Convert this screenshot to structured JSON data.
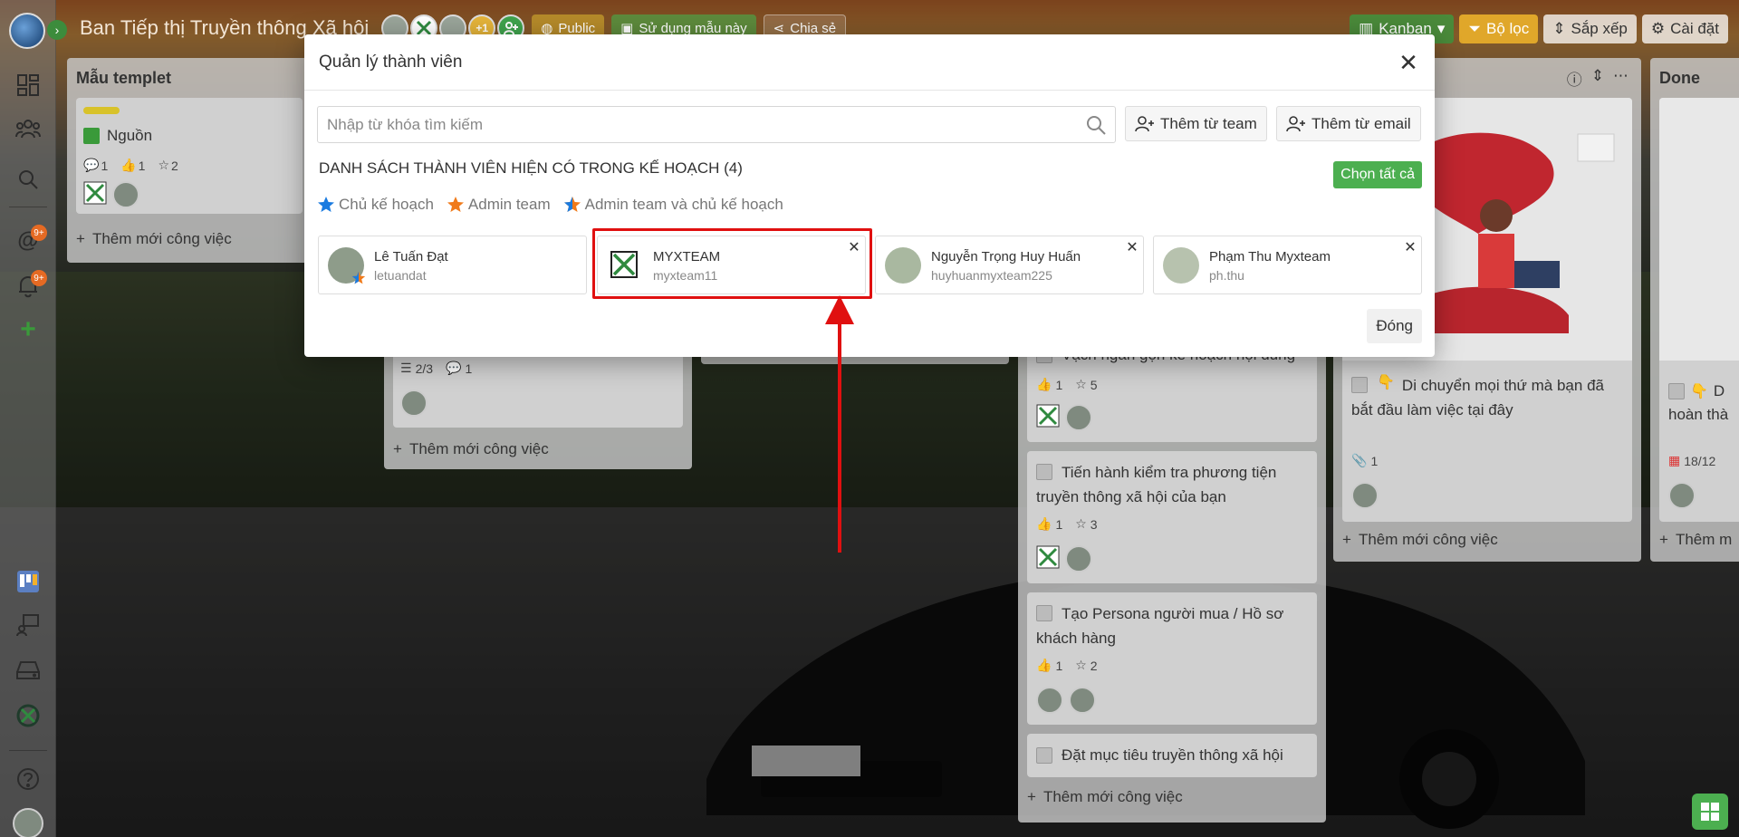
{
  "board": {
    "title": "Ban Tiếp thị Truyền thông Xã hội",
    "more_members": "+1",
    "public_label": "Public",
    "use_template_label": "Sử dụng mẫu này",
    "share_label": "Chia sẻ",
    "view_label": "Kanban",
    "filter_label": "Bộ lọc",
    "sort_label": "Sắp xếp",
    "settings_label": "Cài đặt"
  },
  "sidebar": {
    "mentions_badge": "9+",
    "notifications_badge": "9+"
  },
  "columns": {
    "col1": {
      "title": "Mẫu templet",
      "card_title": "Nguồn",
      "comments": "1",
      "likes": "1",
      "stars": "2",
      "add_task": "Thêm mới công việc"
    },
    "col2": {
      "checklist": "2/3",
      "comments": "1",
      "add_task": "Thêm mới công việc"
    },
    "col4": {
      "cards": [
        {
          "title": "Vạch ngân gọn kế hoạch nội dung",
          "likes": "1",
          "stars": "5"
        },
        {
          "title": "Tiến hành kiểm tra phương tiện truyền thông xã hội của bạn",
          "likes": "1",
          "stars": "3"
        },
        {
          "title": "Tạo Persona người mua / Hồ sơ khách hàng",
          "likes": "1",
          "stars": "2"
        },
        {
          "title": "Đặt mục tiêu truyền thông xã hội"
        }
      ],
      "add_task": "Thêm mới công việc"
    },
    "col5": {
      "card_title": "Di chuyển mọi thứ mà bạn đã bắt đầu làm việc tại đây",
      "attachments": "1",
      "add_task": "Thêm mới công việc"
    },
    "col6": {
      "title": "Done",
      "card_title_fragment": "D",
      "card_title_line2": "hoàn thà",
      "date": "18/12",
      "add_task": "Thêm m"
    }
  },
  "modal": {
    "title": "Quản lý thành viên",
    "search_placeholder": "Nhập từ khóa tìm kiếm",
    "add_from_team": "Thêm từ team",
    "add_from_email": "Thêm từ email",
    "list_heading": "DANH SÁCH THÀNH VIÊN HIỆN CÓ TRONG KẾ HOẠCH (4)",
    "select_all": "Chọn tất cả",
    "legend": {
      "owner": "Chủ kế hoạch",
      "admin": "Admin team",
      "admin_owner": "Admin team và chủ kế hoạch"
    },
    "members": [
      {
        "name": "Lê Tuấn Đạt",
        "username": "letuandat"
      },
      {
        "name": "MYXTEAM",
        "username": "myxteam11"
      },
      {
        "name": "Nguyễn Trọng Huy Huấn",
        "username": "huyhuanmyxteam225"
      },
      {
        "name": "Phạm Thu Myxteam",
        "username": "ph.thu"
      }
    ],
    "close_label": "Đóng"
  },
  "colors": {
    "accent_green": "#4caf50",
    "highlight_red": "#e01010",
    "owner_star": "#1a7be0",
    "admin_star": "#f07a1a"
  }
}
